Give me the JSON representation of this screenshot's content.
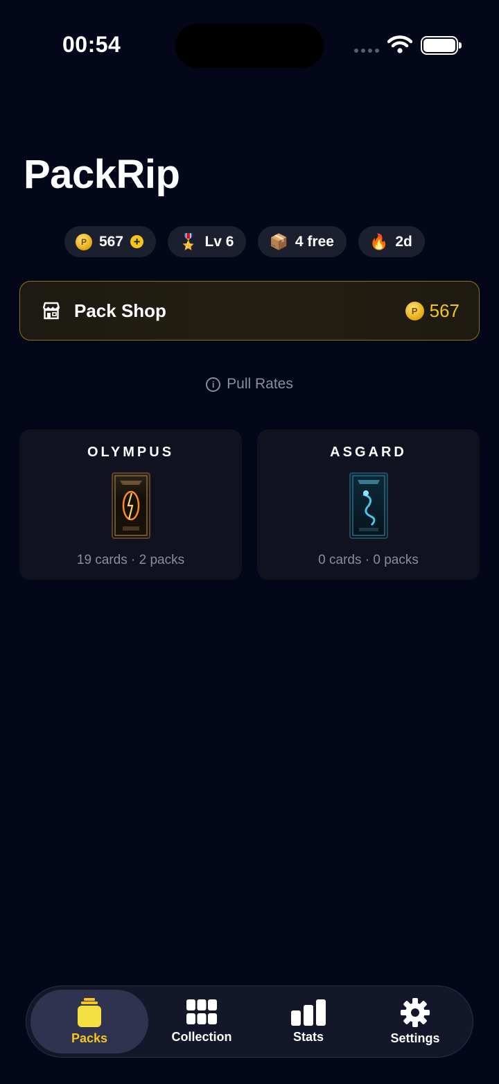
{
  "status_bar": {
    "time": "00:54"
  },
  "app": {
    "title": "PackRip"
  },
  "chips": {
    "coins": {
      "value": "567",
      "icon": "coin-icon",
      "action_icon": "plus-icon"
    },
    "level": {
      "emoji": "🎖️",
      "label": "Lv 6",
      "icon": "medal-icon"
    },
    "free_packs": {
      "emoji": "📦",
      "label": "4 free",
      "icon": "box-icon"
    },
    "streak": {
      "emoji": "🔥",
      "label": "2d",
      "icon": "fire-icon"
    }
  },
  "pack_shop": {
    "label": "Pack Shop",
    "balance": "567",
    "icon": "store-icon",
    "accent": "#f5c518"
  },
  "pull_rates": {
    "label": "Pull Rates",
    "icon": "info-icon"
  },
  "sets": [
    {
      "name": "OLYMPUS",
      "meta": "19 cards · 2 packs"
    },
    {
      "name": "ASGARD",
      "meta": "0 cards · 0 packs"
    }
  ],
  "tabs": [
    {
      "label": "Packs",
      "icon": "packs-icon",
      "active": true
    },
    {
      "label": "Collection",
      "icon": "grid-icon",
      "active": false
    },
    {
      "label": "Stats",
      "icon": "bar-chart-icon",
      "active": false
    },
    {
      "label": "Settings",
      "icon": "gear-icon",
      "active": false
    }
  ],
  "colors": {
    "background": "#04061a",
    "accent": "#f5c518",
    "card": "#10121f",
    "muted_text": "#8a8d9c"
  }
}
